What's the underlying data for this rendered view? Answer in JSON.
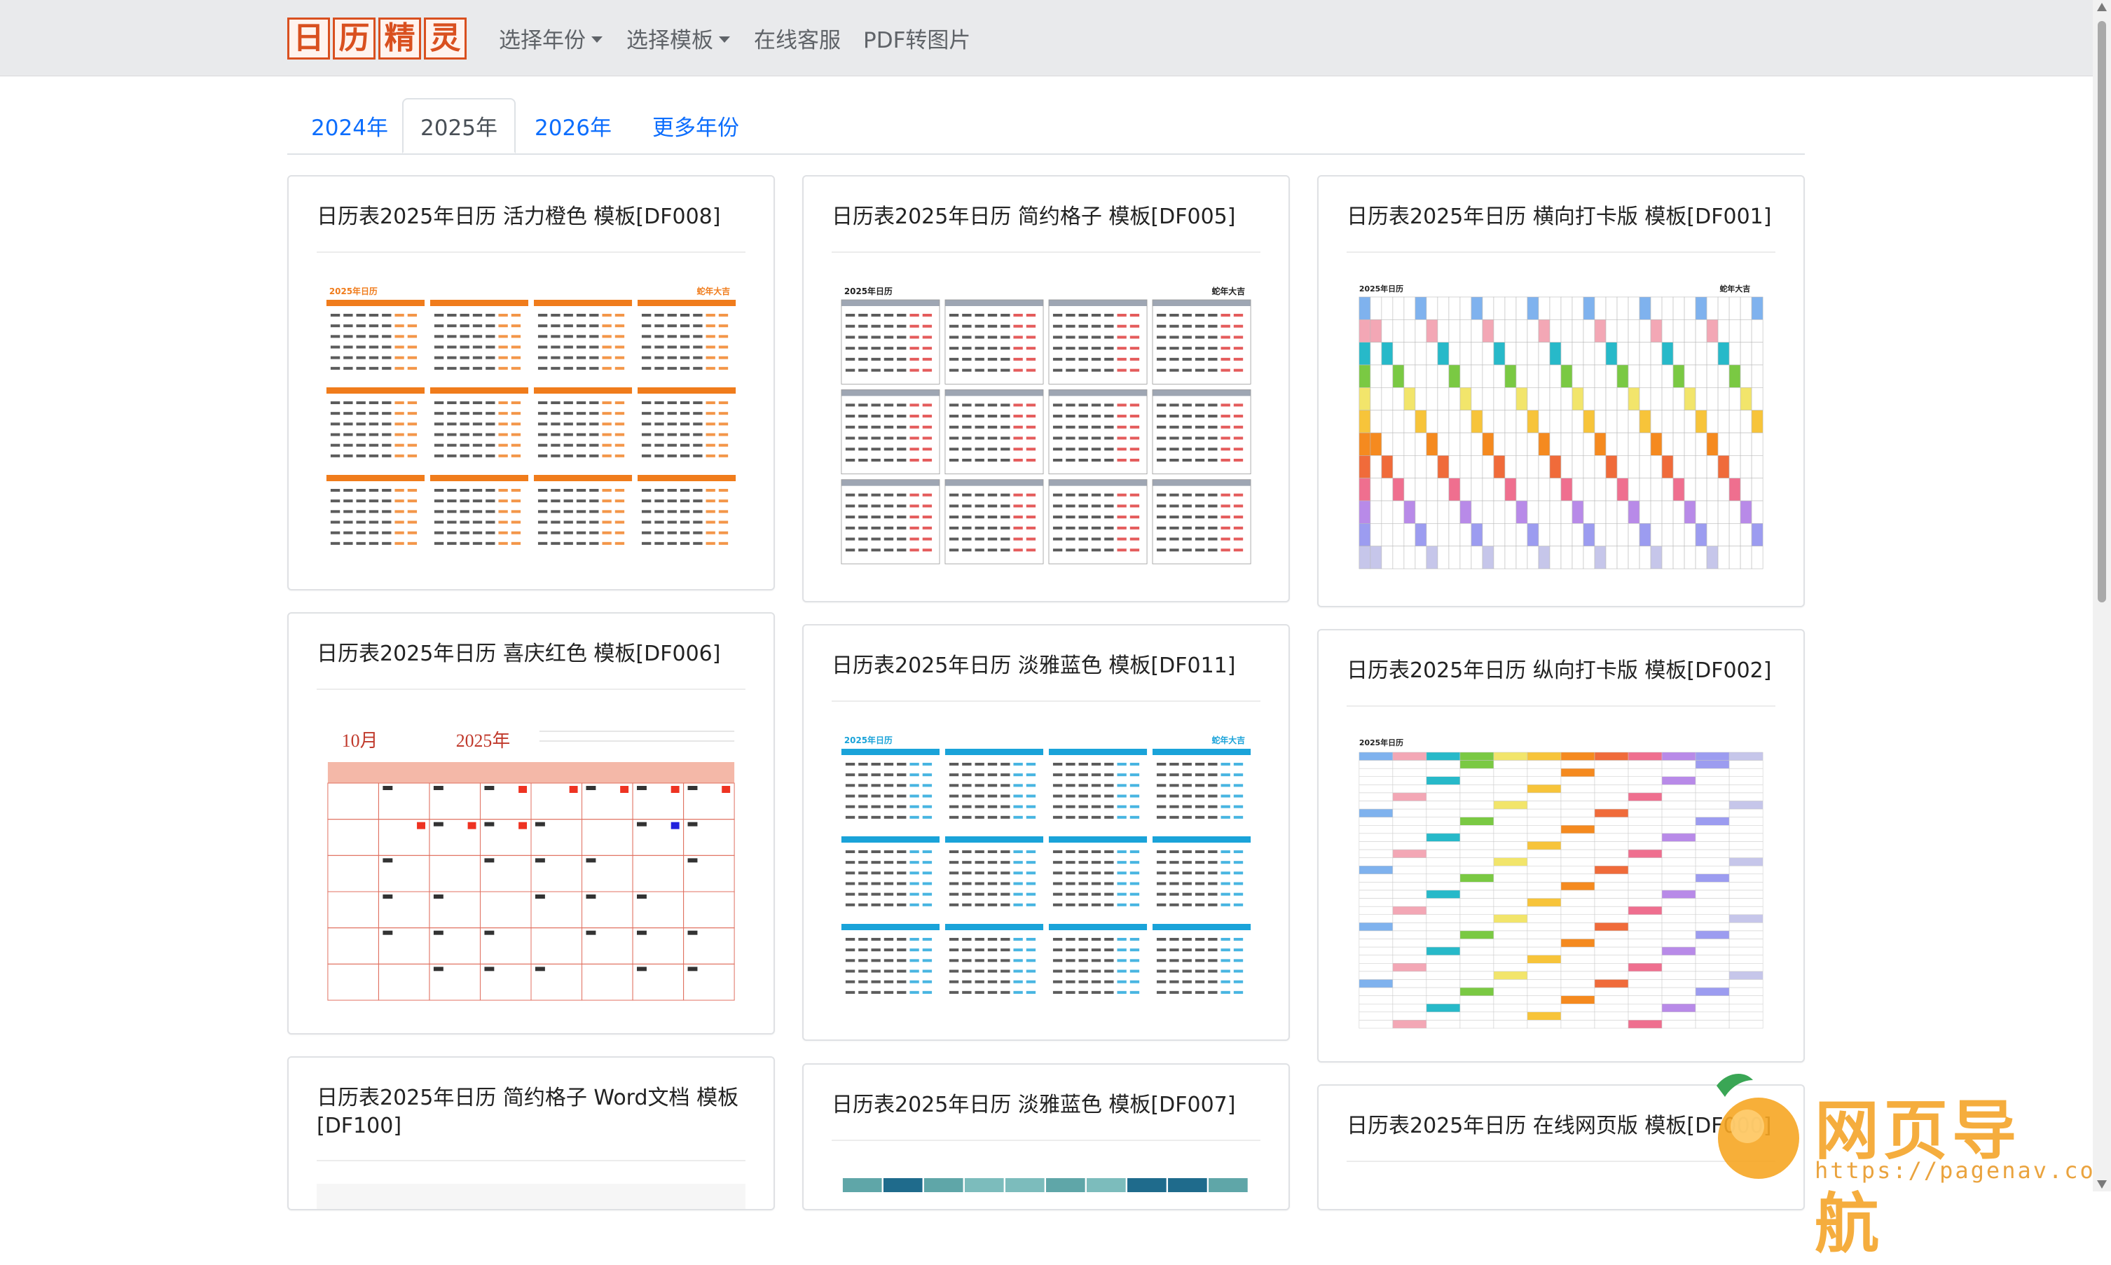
{
  "nav": {
    "logo_chars": [
      "日",
      "历",
      "精",
      "灵"
    ],
    "items": [
      "选择年份",
      "选择模板",
      "在线客服",
      "PDF转图片"
    ]
  },
  "tabs": [
    "2024年",
    "2025年",
    "2026年",
    "更多年份"
  ],
  "active_tab": "2025年",
  "cards": [
    {
      "title": "日历表2025年日历 活力橙色 模板[DF008]"
    },
    {
      "title": "日历表2025年日历 简约格子 模板[DF005]"
    },
    {
      "title": "日历表2025年日历 横向打卡版 模板[DF001]"
    },
    {
      "title": "日历表2025年日历 喜庆红色 模板[DF006]"
    },
    {
      "title": "日历表2025年日历 淡雅蓝色 模板[DF011]"
    },
    {
      "title": "日历表2025年日历 纵向打卡版 模板[DF002]"
    },
    {
      "title": "日历表2025年日历 简约格子 Word文档 模板[DF100]"
    },
    {
      "title": "日历表2025年日历 淡雅蓝色 模板[DF007]"
    },
    {
      "title": "日历表2025年日历 在线网页版 模板[DF000]"
    }
  ],
  "thumb_text": {
    "year_label": "2025年日历",
    "lucky": "蛇年大吉",
    "red_month": "10月",
    "red_year": "2025年"
  },
  "colors": {
    "orange": "#f07c1c",
    "blue": "#1aa3d9",
    "gray": "#8d97a6",
    "red": "#c0392b",
    "brand": "#d9501f",
    "link": "#0d6efd"
  },
  "watermark": {
    "text": "网页导航",
    "url": "https://pagenav.com"
  }
}
